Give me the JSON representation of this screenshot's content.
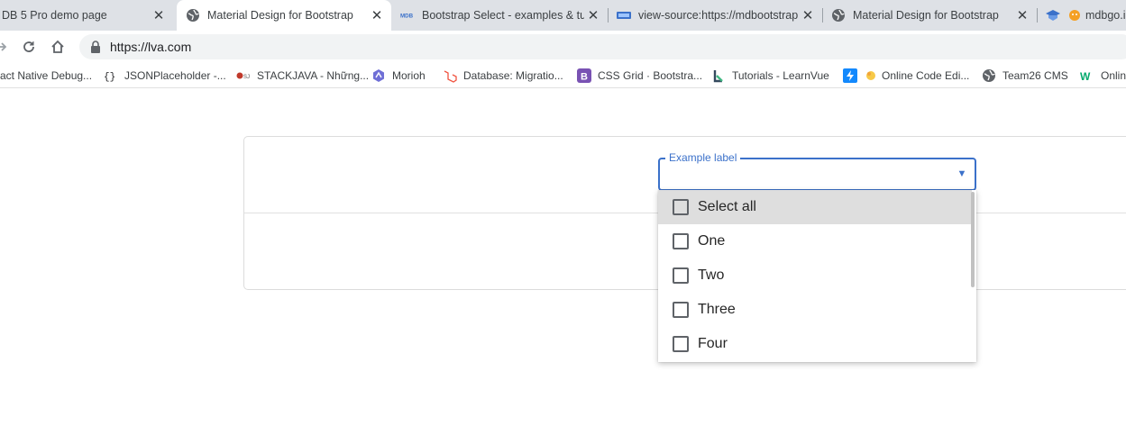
{
  "tabs": [
    {
      "title": "DB 5 Pro demo page",
      "icon": "mdb-icon",
      "active": false
    },
    {
      "title": "Material Design for Bootstrap",
      "icon": "globe-icon",
      "active": true
    },
    {
      "title": "Bootstrap Select - examples & tu",
      "icon": "mdb-icon",
      "active": false
    },
    {
      "title": "view-source:https://mdbootstrap",
      "icon": "mdb-icon",
      "active": false
    },
    {
      "title": "Material Design for Bootstrap",
      "icon": "globe-icon",
      "active": false
    },
    {
      "title": "mdbgo.i",
      "icon": "mdb-icon",
      "active": false
    }
  ],
  "address_bar": {
    "url": "https://lva.com"
  },
  "bookmarks": [
    {
      "label": "act Native Debug...",
      "icon": "react-icon"
    },
    {
      "label": "JSONPlaceholder -...",
      "icon": "json-icon"
    },
    {
      "label": "STACKJAVA - Những...",
      "icon": "stackjava-icon"
    },
    {
      "label": "Morioh",
      "icon": "morioh-icon"
    },
    {
      "label": "Database: Migratio...",
      "icon": "laravel-icon"
    },
    {
      "label": "CSS Grid · Bootstra...",
      "icon": "bootstrap-icon"
    },
    {
      "label": "Tutorials - LearnVue",
      "icon": "learnvue-icon"
    },
    {
      "label": "Online Code Edi...",
      "icon": "code-editor-icon"
    },
    {
      "label": "Team26 CMS",
      "icon": "globe-icon"
    },
    {
      "label": "Onlin",
      "icon": "w3-icon"
    }
  ],
  "select": {
    "label": "Example label",
    "value": "",
    "options": [
      {
        "label": "Select all",
        "checked": false,
        "highlighted": true
      },
      {
        "label": "One",
        "checked": false,
        "highlighted": false
      },
      {
        "label": "Two",
        "checked": false,
        "highlighted": false
      },
      {
        "label": "Three",
        "checked": false,
        "highlighted": false
      },
      {
        "label": "Four",
        "checked": false,
        "highlighted": false
      }
    ]
  },
  "colors": {
    "accent": "#3b71ca",
    "highlight": "#dedede"
  }
}
